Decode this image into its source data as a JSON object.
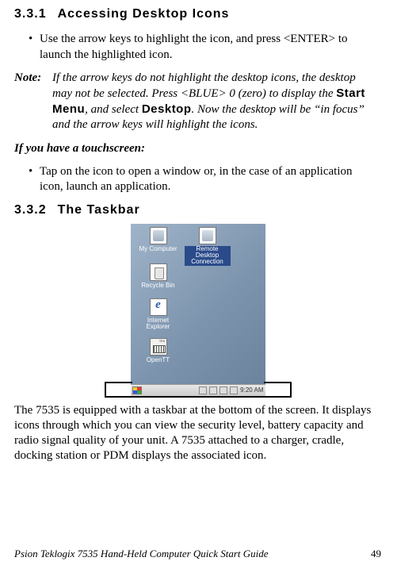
{
  "section1": {
    "number": "3.3.1",
    "title": "Accessing Desktop Icons"
  },
  "bullet1": "Use the arrow keys to highlight the icon, and press <ENTER> to launch the highlighted icon.",
  "note": {
    "label": "Note:",
    "before_start": "If the arrow keys do not highlight the desktop icons, the desktop may not be selected. Press <BLUE> 0 (zero) to display the ",
    "start_menu": "Start Menu",
    "middle": ", and select ",
    "desktop_word": "Desktop",
    "after": ". Now the desktop will be “in focus” and the arrow keys will highlight the icons."
  },
  "touchscreen_line": "If you have a touchscreen",
  "bullet2": "Tap on the icon to open a window or, in the case of an application icon, launch an application.",
  "section2": {
    "number": "3.3.2",
    "title": "The Taskbar"
  },
  "screenshot": {
    "icons": {
      "my_computer": "My Computer",
      "remote_desktop": "Remote Desktop Connection",
      "recycle_bin": "Recycle Bin",
      "internet_explorer": "Internet Explorer",
      "opentt": "OpenTT"
    },
    "taskbar_time": "9:20 AM"
  },
  "body_para": "The 7535 is equipped with a taskbar at the bottom of the screen. It displays icons through which you can view the security level, battery capacity and radio signal quality of your unit. A 7535 attached to a charger, cradle, docking station or PDM displays the associated icon.",
  "footer": {
    "left": "Psion Teklogix 7535 Hand-Held Computer Quick Start Guide",
    "page": "49"
  }
}
